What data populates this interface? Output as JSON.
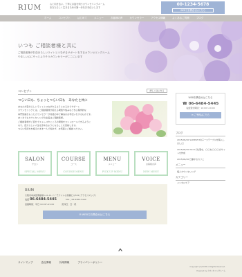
{
  "header": {
    "logo": "RIUM",
    "tagline_line1": "心と向き合い、丁寧にお話を伺うカウンセリングルーム",
    "tagline_line2": "あなたらしく生きるための第一歩をお手伝いします",
    "phone": "00-1234-5678",
    "contact_button": "WEBでお問合せはこちら"
  },
  "nav": [
    "ホーム",
    "コンセプト",
    "はじめて",
    "メニュー",
    "お客様の声",
    "カウンセラー",
    "アクセス情報",
    "よくあるご質問",
    "ブログ"
  ],
  "hero": {
    "title": "いつも ご相談者様と共に",
    "text_line1": "ご相談者様がお自分らしいライトとつながるサポートをするカウンセリングルーム",
    "text_line2": "やましい心にそっとよりそうカウンセラーがここにいます"
  },
  "concept": {
    "heading": "コンセプト",
    "more": "詳しくはこちら",
    "title": "つらい日も、ちょっとつらい日も　あなたと共に",
    "body": [
      "あなたが自分らしいライトとつながれるようになるまでサポート",
      "カウンセリングとは、ご相談者様が抱える問題や悩みなどを心理学的な",
      "専門知識をもったカウンセラーが対話の中で解決のお手伝いをするものです。",
      "あくまでもカウンセリングの主役はご相談者様。",
      "ご相談者様がご自分でストレスやこころの問題をコントロールできるように",
      "なり、自分らしい人生を歩めるようになることを目指します。",
      "つらい気持ちを抱えたまま一人で悩まず、お気軽にご相談ください。"
    ]
  },
  "services": [
    {
      "title": "SALON",
      "sub": "サロン",
      "en": "SPECIAL MENU"
    },
    {
      "title": "COURSE",
      "sub": "コース",
      "en": "COURSE MENU"
    },
    {
      "title": "MENU",
      "sub": "メニュー",
      "en": "PICK UP MENU"
    },
    {
      "title": "VOICE",
      "sub": "お客様の声",
      "en": "NEW MENU"
    }
  ],
  "info": {
    "name": "RIUM",
    "address": "大阪市中央区南船場1-11-11 ハーモナイト心斎橋ビル501 [アクセスマップ]",
    "tel_label": "電話",
    "phone": "06-6484-5445",
    "fax": "FAX：06-6484-5444",
    "hours": "営業時間：平日 10:00～21:00",
    "closed": "定休日：日・祝",
    "button": "WEBでお問合せはこちら"
  },
  "sidebar": {
    "contact_title": "WEBお問合せはこちら",
    "phone": "☎ 06-6484-5445",
    "hours": "電話受付時間：10:00～19:00",
    "contact_button": "ご予約はこちら",
    "blog_heading": "ブログ",
    "blog_items": [
      "2015/06/20 SAMPLE 8の子ーステーブルを購入しました！",
      "2015/06/20 Wordで仕事を、◯◯を◯◯◯のサイトを作成",
      "2015/06/20 仕事するカフェ"
    ],
    "menu_heading": "メニュー",
    "menu_items": [
      "個人カウンセリング"
    ],
    "archive_heading": "カテゴリー",
    "archive_items": [
      "メンタルケア"
    ]
  },
  "footer": {
    "links": [
      "サイトマップ",
      "会社情報",
      "採用情報",
      "プライバシーポリシー"
    ],
    "copyright1": "Copyright (C) RIUM All Rights Reserved.",
    "copyright2": "Powered by カウンセリングルーム"
  }
}
